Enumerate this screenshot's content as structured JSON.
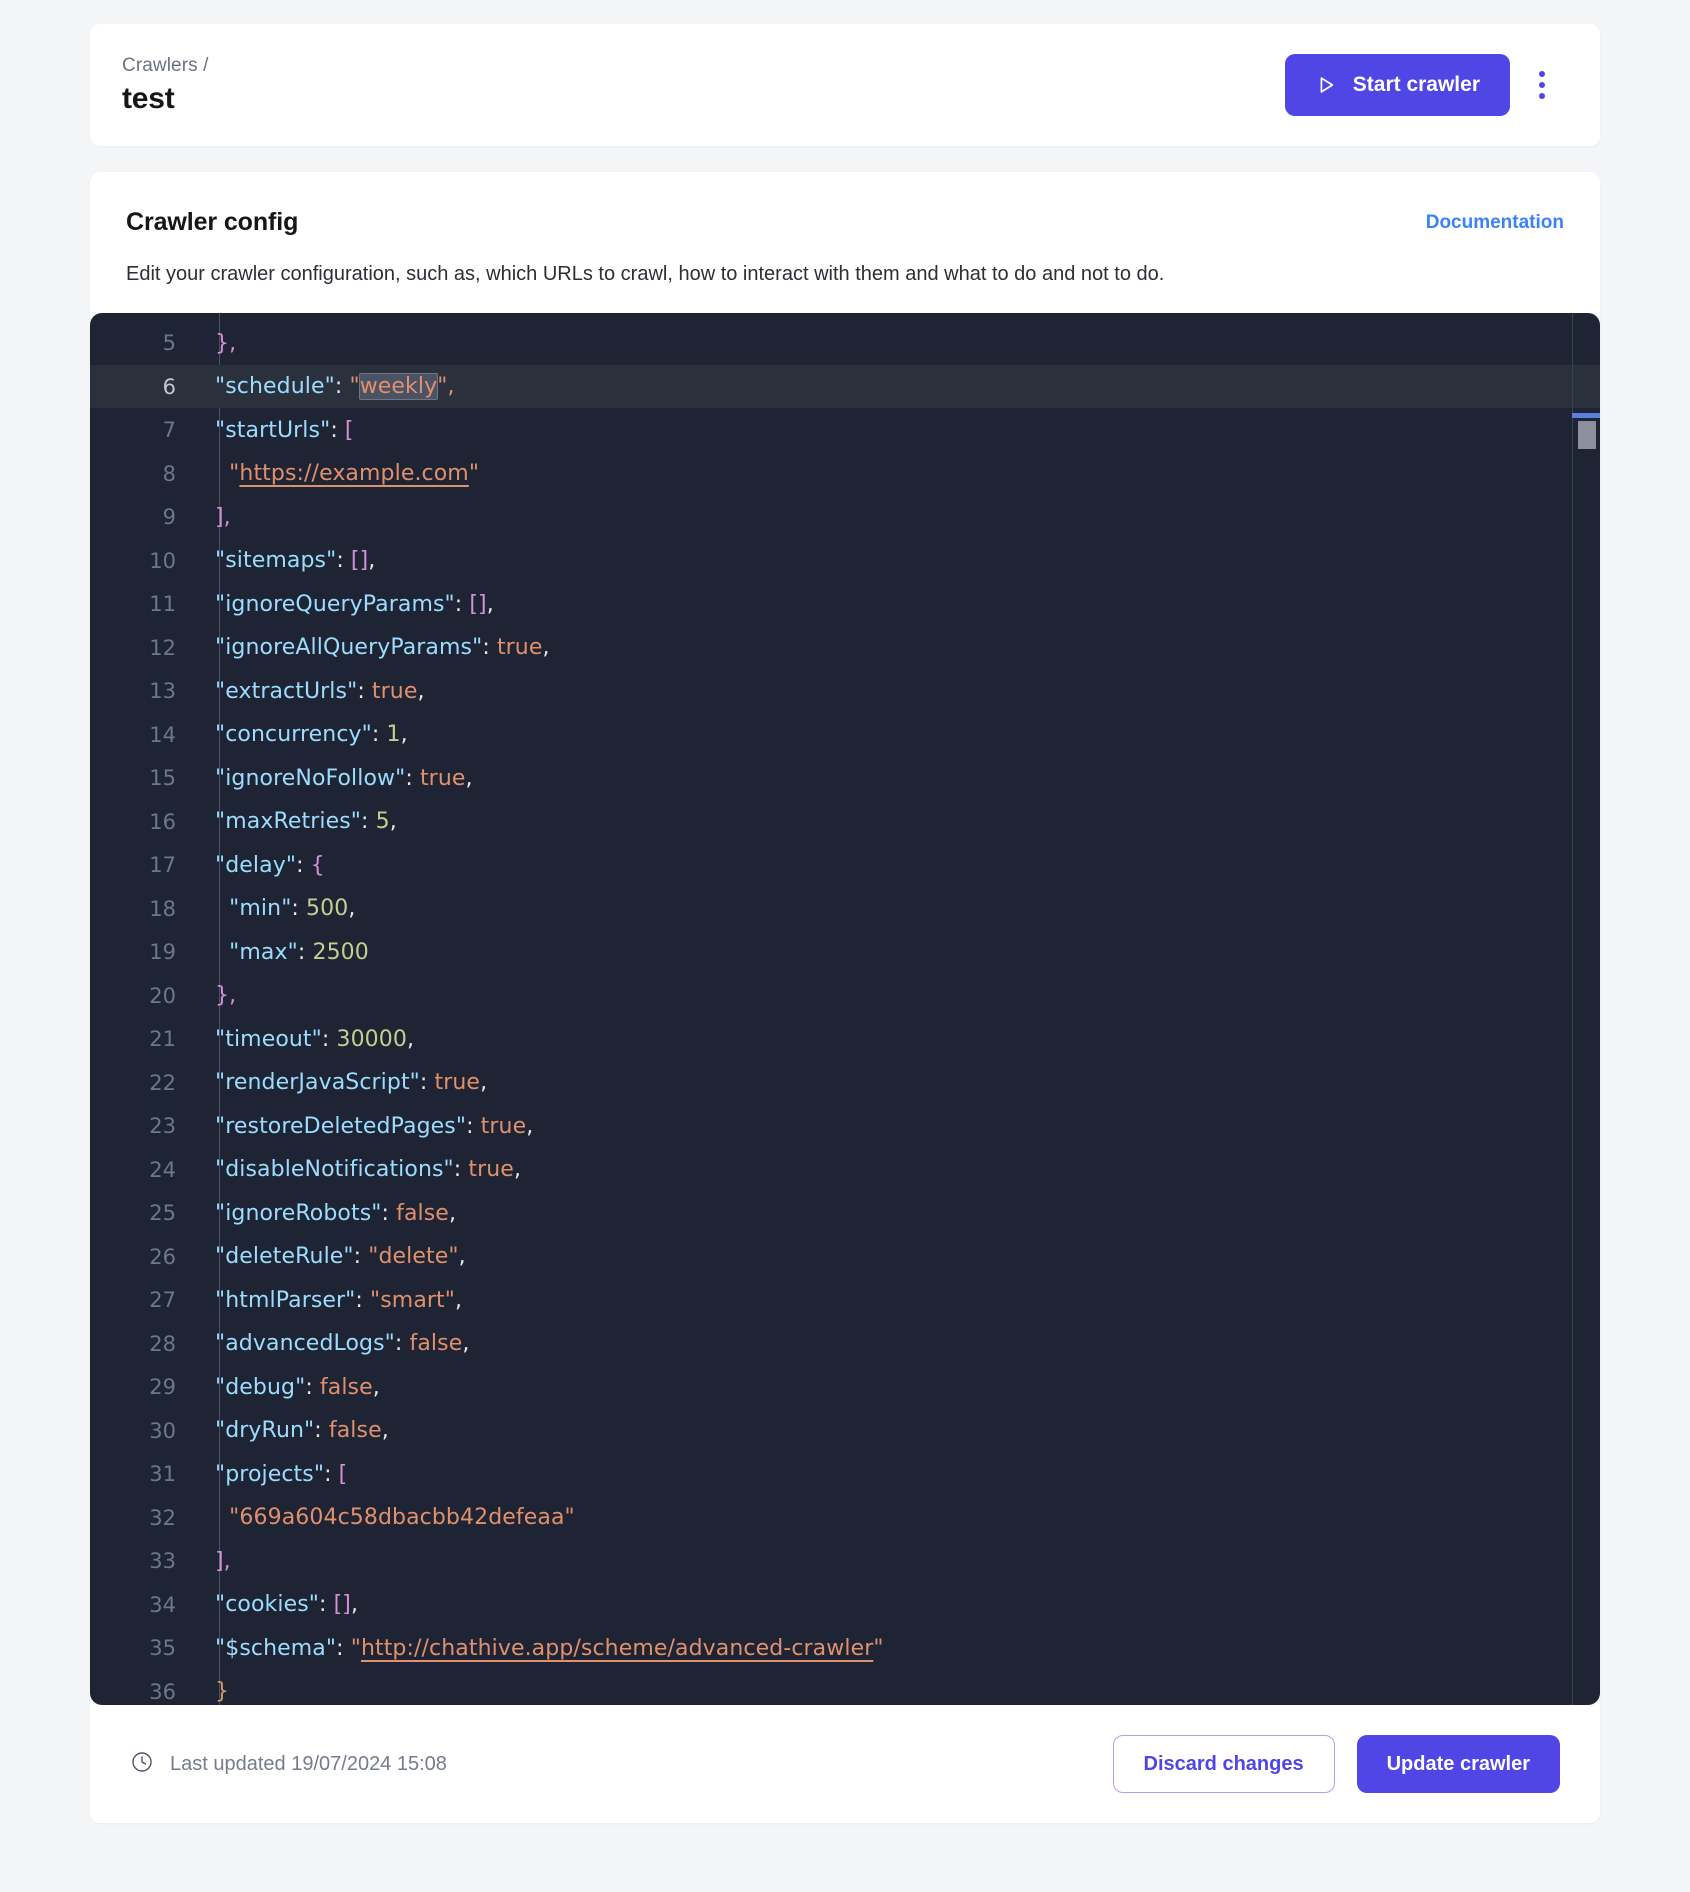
{
  "header": {
    "breadcrumb": "Crawlers /",
    "title": "test",
    "start_button_label": "Start crawler",
    "start_button_icon": "play-triangle-icon",
    "kebab_icon": "more-vertical-icon",
    "accent_color": "#4f46e5"
  },
  "config_section": {
    "title": "Crawler config",
    "documentation_label": "Documentation",
    "documentation_color": "#3b82f6",
    "description": "Edit your crawler configuration, such as, which URLs to crawl, how to interact with them and what to do and not to do."
  },
  "editor": {
    "background_color": "#1e2433",
    "active_line": 6,
    "selected_word": "weekly",
    "first_visible_line": 5,
    "last_visible_line": 36,
    "lines": [
      {
        "n": 5,
        "tokens": [
          {
            "t": "},",
            "c": "tok-brak"
          }
        ]
      },
      {
        "n": 6,
        "tokens": [
          {
            "t": "\"schedule\"",
            "c": "tok-key"
          },
          {
            "t": ": ",
            "c": "tok-punct"
          },
          {
            "t": "\"",
            "c": "tok-str"
          },
          {
            "t": "weekly",
            "c": "tok-str tok-sel"
          },
          {
            "t": "\",",
            "c": "tok-str"
          }
        ]
      },
      {
        "n": 7,
        "tokens": [
          {
            "t": "\"startUrls\"",
            "c": "tok-key"
          },
          {
            "t": ": ",
            "c": "tok-punct"
          },
          {
            "t": "[",
            "c": "tok-brak"
          }
        ]
      },
      {
        "n": 8,
        "tokens": [
          {
            "t": "  \"",
            "c": "tok-str"
          },
          {
            "t": "https://example.com",
            "c": "tok-link"
          },
          {
            "t": "\"",
            "c": "tok-str"
          }
        ]
      },
      {
        "n": 9,
        "tokens": [
          {
            "t": "],",
            "c": "tok-brak"
          }
        ]
      },
      {
        "n": 10,
        "tokens": [
          {
            "t": "\"sitemaps\"",
            "c": "tok-key"
          },
          {
            "t": ": ",
            "c": "tok-punct"
          },
          {
            "t": "[]",
            "c": "tok-brak"
          },
          {
            "t": ",",
            "c": "tok-punct"
          }
        ]
      },
      {
        "n": 11,
        "tokens": [
          {
            "t": "\"ignoreQueryParams\"",
            "c": "tok-key"
          },
          {
            "t": ": ",
            "c": "tok-punct"
          },
          {
            "t": "[]",
            "c": "tok-brak"
          },
          {
            "t": ",",
            "c": "tok-punct"
          }
        ]
      },
      {
        "n": 12,
        "tokens": [
          {
            "t": "\"ignoreAllQueryParams\"",
            "c": "tok-key"
          },
          {
            "t": ": ",
            "c": "tok-punct"
          },
          {
            "t": "true",
            "c": "tok-bool"
          },
          {
            "t": ",",
            "c": "tok-punct"
          }
        ]
      },
      {
        "n": 13,
        "tokens": [
          {
            "t": "\"extractUrls\"",
            "c": "tok-key"
          },
          {
            "t": ": ",
            "c": "tok-punct"
          },
          {
            "t": "true",
            "c": "tok-bool"
          },
          {
            "t": ",",
            "c": "tok-punct"
          }
        ]
      },
      {
        "n": 14,
        "tokens": [
          {
            "t": "\"concurrency\"",
            "c": "tok-key"
          },
          {
            "t": ": ",
            "c": "tok-punct"
          },
          {
            "t": "1",
            "c": "tok-num"
          },
          {
            "t": ",",
            "c": "tok-punct"
          }
        ]
      },
      {
        "n": 15,
        "tokens": [
          {
            "t": "\"ignoreNoFollow\"",
            "c": "tok-key"
          },
          {
            "t": ": ",
            "c": "tok-punct"
          },
          {
            "t": "true",
            "c": "tok-bool"
          },
          {
            "t": ",",
            "c": "tok-punct"
          }
        ]
      },
      {
        "n": 16,
        "tokens": [
          {
            "t": "\"maxRetries\"",
            "c": "tok-key"
          },
          {
            "t": ": ",
            "c": "tok-punct"
          },
          {
            "t": "5",
            "c": "tok-num"
          },
          {
            "t": ",",
            "c": "tok-punct"
          }
        ]
      },
      {
        "n": 17,
        "tokens": [
          {
            "t": "\"delay\"",
            "c": "tok-key"
          },
          {
            "t": ": ",
            "c": "tok-punct"
          },
          {
            "t": "{",
            "c": "tok-brak"
          }
        ]
      },
      {
        "n": 18,
        "tokens": [
          {
            "t": "  \"min\"",
            "c": "tok-key"
          },
          {
            "t": ": ",
            "c": "tok-punct"
          },
          {
            "t": "500",
            "c": "tok-num"
          },
          {
            "t": ",",
            "c": "tok-punct"
          }
        ]
      },
      {
        "n": 19,
        "tokens": [
          {
            "t": "  \"max\"",
            "c": "tok-key"
          },
          {
            "t": ": ",
            "c": "tok-punct"
          },
          {
            "t": "2500",
            "c": "tok-num"
          }
        ]
      },
      {
        "n": 20,
        "tokens": [
          {
            "t": "},",
            "c": "tok-brak"
          }
        ]
      },
      {
        "n": 21,
        "tokens": [
          {
            "t": "\"timeout\"",
            "c": "tok-key"
          },
          {
            "t": ": ",
            "c": "tok-punct"
          },
          {
            "t": "30000",
            "c": "tok-num"
          },
          {
            "t": ",",
            "c": "tok-punct"
          }
        ]
      },
      {
        "n": 22,
        "tokens": [
          {
            "t": "\"renderJavaScript\"",
            "c": "tok-key"
          },
          {
            "t": ": ",
            "c": "tok-punct"
          },
          {
            "t": "true",
            "c": "tok-bool"
          },
          {
            "t": ",",
            "c": "tok-punct"
          }
        ]
      },
      {
        "n": 23,
        "tokens": [
          {
            "t": "\"restoreDeletedPages\"",
            "c": "tok-key"
          },
          {
            "t": ": ",
            "c": "tok-punct"
          },
          {
            "t": "true",
            "c": "tok-bool"
          },
          {
            "t": ",",
            "c": "tok-punct"
          }
        ]
      },
      {
        "n": 24,
        "tokens": [
          {
            "t": "\"disableNotifications\"",
            "c": "tok-key"
          },
          {
            "t": ": ",
            "c": "tok-punct"
          },
          {
            "t": "true",
            "c": "tok-bool"
          },
          {
            "t": ",",
            "c": "tok-punct"
          }
        ]
      },
      {
        "n": 25,
        "tokens": [
          {
            "t": "\"ignoreRobots\"",
            "c": "tok-key"
          },
          {
            "t": ": ",
            "c": "tok-punct"
          },
          {
            "t": "false",
            "c": "tok-bool"
          },
          {
            "t": ",",
            "c": "tok-punct"
          }
        ]
      },
      {
        "n": 26,
        "tokens": [
          {
            "t": "\"deleteRule\"",
            "c": "tok-key"
          },
          {
            "t": ": ",
            "c": "tok-punct"
          },
          {
            "t": "\"delete\"",
            "c": "tok-str"
          },
          {
            "t": ",",
            "c": "tok-punct"
          }
        ]
      },
      {
        "n": 27,
        "tokens": [
          {
            "t": "\"htmlParser\"",
            "c": "tok-key"
          },
          {
            "t": ": ",
            "c": "tok-punct"
          },
          {
            "t": "\"smart\"",
            "c": "tok-str"
          },
          {
            "t": ",",
            "c": "tok-punct"
          }
        ]
      },
      {
        "n": 28,
        "tokens": [
          {
            "t": "\"advancedLogs\"",
            "c": "tok-key"
          },
          {
            "t": ": ",
            "c": "tok-punct"
          },
          {
            "t": "false",
            "c": "tok-bool"
          },
          {
            "t": ",",
            "c": "tok-punct"
          }
        ]
      },
      {
        "n": 29,
        "tokens": [
          {
            "t": "\"debug\"",
            "c": "tok-key"
          },
          {
            "t": ": ",
            "c": "tok-punct"
          },
          {
            "t": "false",
            "c": "tok-bool"
          },
          {
            "t": ",",
            "c": "tok-punct"
          }
        ]
      },
      {
        "n": 30,
        "tokens": [
          {
            "t": "\"dryRun\"",
            "c": "tok-key"
          },
          {
            "t": ": ",
            "c": "tok-punct"
          },
          {
            "t": "false",
            "c": "tok-bool"
          },
          {
            "t": ",",
            "c": "tok-punct"
          }
        ]
      },
      {
        "n": 31,
        "tokens": [
          {
            "t": "\"projects\"",
            "c": "tok-key"
          },
          {
            "t": ": ",
            "c": "tok-punct"
          },
          {
            "t": "[",
            "c": "tok-brak"
          }
        ]
      },
      {
        "n": 32,
        "tokens": [
          {
            "t": "  \"669a604c58dbacbb42defeaa\"",
            "c": "tok-str"
          }
        ]
      },
      {
        "n": 33,
        "tokens": [
          {
            "t": "],",
            "c": "tok-brak"
          }
        ]
      },
      {
        "n": 34,
        "tokens": [
          {
            "t": "\"cookies\"",
            "c": "tok-key"
          },
          {
            "t": ": ",
            "c": "tok-punct"
          },
          {
            "t": "[]",
            "c": "tok-brak"
          },
          {
            "t": ",",
            "c": "tok-punct"
          }
        ]
      },
      {
        "n": 35,
        "tokens": [
          {
            "t": "\"$schema\"",
            "c": "tok-key"
          },
          {
            "t": ": ",
            "c": "tok-punct"
          },
          {
            "t": "\"",
            "c": "tok-str"
          },
          {
            "t": "http://chathive.app/scheme/advanced-crawler",
            "c": "tok-link"
          },
          {
            "t": "\"",
            "c": "tok-str"
          }
        ]
      },
      {
        "n": 36,
        "tokens": [
          {
            "t": "}",
            "c": "tok-brace-root"
          }
        ]
      }
    ]
  },
  "footer": {
    "clock_icon": "clock-icon",
    "last_updated_label": "Last updated 19/07/2024 15:08",
    "discard_label": "Discard changes",
    "update_label": "Update crawler"
  }
}
